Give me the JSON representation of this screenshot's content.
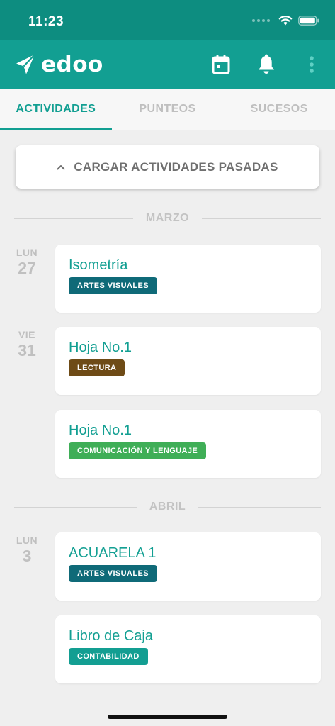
{
  "status": {
    "time": "11:23"
  },
  "app": {
    "logo_text": "edoo"
  },
  "tabs": [
    {
      "label": "ACTIVIDADES",
      "active": true
    },
    {
      "label": "PUNTEOS",
      "active": false
    },
    {
      "label": "SUCESOS",
      "active": false
    }
  ],
  "load_past": {
    "label": "CARGAR ACTIVIDADES PASADAS"
  },
  "months": [
    "MARZO",
    "ABRIL"
  ],
  "days": [
    {
      "dow": "LUN",
      "num": "27"
    },
    {
      "dow": "VIE",
      "num": "31"
    },
    {
      "dow": "LUN",
      "num": "3"
    }
  ],
  "activities": [
    {
      "title": "Isometría",
      "tag": "ARTES VISUALES",
      "tag_color": "#0f6a78"
    },
    {
      "title": "Hoja No.1",
      "tag": "LECTURA",
      "tag_color": "#6e4b16"
    },
    {
      "title": "Hoja No.1",
      "tag": "COMUNICACIÓN Y LENGUAJE",
      "tag_color": "#3fae57"
    },
    {
      "title": "ACUARELA 1",
      "tag": "ARTES VISUALES",
      "tag_color": "#0f6a78"
    },
    {
      "title": "Libro de Caja",
      "tag": "CONTABILIDAD",
      "tag_color": "#139e92"
    }
  ],
  "icons": {
    "logo": "paper-plane-icon",
    "calendar": "calendar-icon",
    "notifications": "bell-icon",
    "menu": "more-vertical-icon",
    "load": "chevron-up-icon"
  },
  "colors": {
    "primary": "#129f92",
    "status_bar": "#0d8d80",
    "background": "#efefef"
  }
}
